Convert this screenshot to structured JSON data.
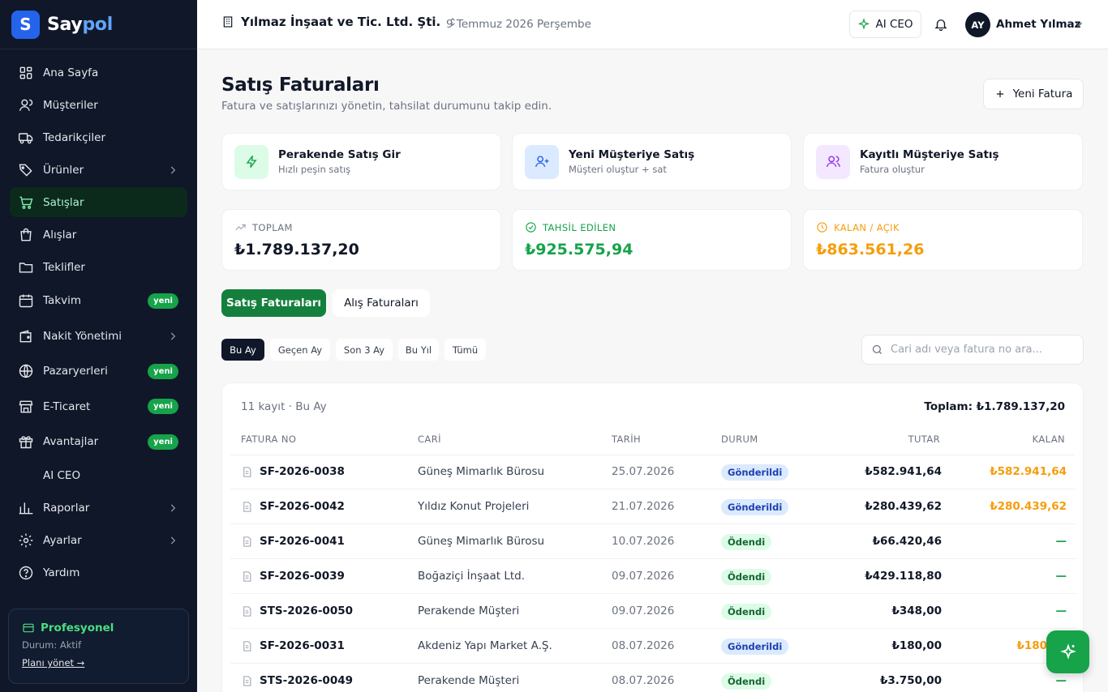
{
  "brand": {
    "name_a": "Say",
    "name_b": "pol",
    "logo_letter": "S",
    "accent": "#2563eb"
  },
  "sidebar": {
    "items": [
      {
        "label": "Ana Sayfa",
        "icon": "grid-icon"
      },
      {
        "label": "Müşteriler",
        "icon": "user-icon"
      },
      {
        "label": "Tedarikçiler",
        "icon": "truck-icon"
      },
      {
        "label": "Ürünler",
        "icon": "tag-icon"
      },
      {
        "label": "Satışlar",
        "icon": "cart-icon"
      },
      {
        "label": "Alışlar",
        "icon": "bag-icon"
      },
      {
        "label": "Teklifler",
        "icon": "folder-icon"
      },
      {
        "label": "Takvim",
        "icon": "calendar-icon",
        "badge": "yeni"
      },
      {
        "label": "Nakit Yönetimi",
        "icon": "wallet-icon"
      },
      {
        "label": "Pazaryerleri",
        "icon": "globe-icon",
        "badge": "yeni"
      },
      {
        "label": "E-Ticaret",
        "icon": "store-icon",
        "badge": "yeni"
      },
      {
        "label": "Avantajlar",
        "icon": "gift-icon",
        "badge": "yeni"
      },
      {
        "label": "AI CEO",
        "icon": "cpu-icon"
      },
      {
        "label": "Raporlar",
        "icon": "chart-icon"
      },
      {
        "label": "Ayarlar",
        "icon": "gear-icon"
      },
      {
        "label": "Yardım",
        "icon": "help-icon"
      }
    ],
    "plan": {
      "title": "Profesyonel",
      "status": "Durum: Aktif",
      "link": "Planı yönet →"
    }
  },
  "topbar": {
    "company": "Yılmaz İnşaat ve Tic. Ltd. Şti.",
    "date": "9 Temmuz 2026 Perşembe",
    "ai_label": "AI CEO",
    "avatar": "AY",
    "user": "Ahmet Yılmaz"
  },
  "page": {
    "title": "Satış Faturaları",
    "subtitle": "Fatura ve satışlarınızı yönetin, tahsilat durumunu takip edin.",
    "new_button": "Yeni Fatura"
  },
  "quick_actions": [
    {
      "title": "Perakende Satış Gir",
      "sub": "Hızlı peşin satış",
      "icon": "bolt-icon",
      "color": "#16a34a",
      "bg": "#dcfce7"
    },
    {
      "title": "Yeni Müşteriye Satış",
      "sub": "Müşteri oluştur + sat",
      "icon": "user-plus-icon",
      "color": "#2563eb",
      "bg": "#dbeafe"
    },
    {
      "title": "Kayıtlı Müşteriye Satış",
      "sub": "Fatura oluştur",
      "icon": "users-icon",
      "color": "#9333ea",
      "bg": "#f3e8ff"
    }
  ],
  "stats": [
    {
      "label": "TOPLAM",
      "value": "₺1.789.137,20",
      "icon": "trend-icon",
      "color": "#111827",
      "label_color": "#6b7280"
    },
    {
      "label": "TAHSİL EDİLEN",
      "value": "₺925.575,94",
      "icon": "check-circle-icon",
      "color": "#16a34a",
      "label_color": "#16a34a"
    },
    {
      "label": "KALAN / AÇIK",
      "value": "₺863.561,26",
      "icon": "clock-icon",
      "color": "#f59e0b",
      "label_color": "#f59e0b"
    }
  ],
  "tabs": {
    "sales": "Satış Faturaları",
    "purchase": "Alış Faturaları"
  },
  "periods": [
    "Bu Ay",
    "Geçen Ay",
    "Son 3 Ay",
    "Bu Yıl",
    "Tümü"
  ],
  "search": {
    "placeholder": "Cari adı veya fatura no ara..."
  },
  "table": {
    "count": "11 kayıt · Bu Ay",
    "total": "Toplam: ₺1.789.137,20",
    "headers": {
      "no": "FATURA NO",
      "cari": "CARİ",
      "date": "TARİH",
      "status": "DURUM",
      "amount": "TUTAR",
      "rem": "KALAN"
    },
    "rows": [
      {
        "no": "SF-2026-0038",
        "cari": "Güneş Mimarlık Bürosu",
        "date": "25.07.2026",
        "status": "Gönderildi",
        "kind": "sent",
        "amount": "₺582.941,64",
        "rem": "₺582.941,64"
      },
      {
        "no": "SF-2026-0042",
        "cari": "Yıldız Konut Projeleri",
        "date": "21.07.2026",
        "status": "Gönderildi",
        "kind": "sent",
        "amount": "₺280.439,62",
        "rem": "₺280.439,62"
      },
      {
        "no": "SF-2026-0041",
        "cari": "Güneş Mimarlık Bürosu",
        "date": "10.07.2026",
        "status": "Ödendi",
        "kind": "paid",
        "amount": "₺66.420,46",
        "rem": "—"
      },
      {
        "no": "SF-2026-0039",
        "cari": "Boğaziçi İnşaat Ltd.",
        "date": "09.07.2026",
        "status": "Ödendi",
        "kind": "paid",
        "amount": "₺429.118,80",
        "rem": "—"
      },
      {
        "no": "STS-2026-0050",
        "cari": "Perakende Müşteri",
        "date": "09.07.2026",
        "status": "Ödendi",
        "kind": "paid",
        "amount": "₺348,00",
        "rem": "—"
      },
      {
        "no": "SF-2026-0031",
        "cari": "Akdeniz Yapı Market A.Ş.",
        "date": "08.07.2026",
        "status": "Gönderildi",
        "kind": "sent",
        "amount": "₺180,00",
        "rem": "₺180,00"
      },
      {
        "no": "STS-2026-0049",
        "cari": "Perakende Müşteri",
        "date": "08.07.2026",
        "status": "Ödendi",
        "kind": "paid",
        "amount": "₺3.750,00",
        "rem": "—"
      }
    ]
  }
}
